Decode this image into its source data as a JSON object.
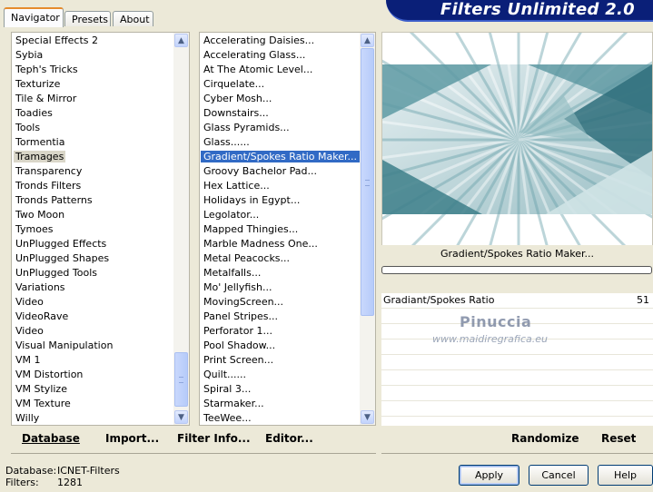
{
  "tabs": [
    {
      "label": "Navigator",
      "active": true
    },
    {
      "label": "Presets",
      "active": false
    },
    {
      "label": "About",
      "active": false
    }
  ],
  "banner": {
    "title": "Filters Unlimited 2.0"
  },
  "categories": {
    "items": [
      "Special Effects 2",
      "Sybia",
      "Teph's Tricks",
      "Texturize",
      "Tile & Mirror",
      "Toadies",
      "Tools",
      "Tormentia",
      "Tramages",
      "Transparency",
      "Tronds Filters",
      "Tronds Patterns",
      "Two Moon",
      "Tymoes",
      "UnPlugged Effects",
      "UnPlugged Shapes",
      "UnPlugged Tools",
      "Variations",
      "Video",
      "VideoRave",
      "Video",
      "Visual Manipulation",
      "VM 1",
      "VM Distortion",
      "VM Stylize",
      "VM Texture",
      "Willy"
    ],
    "selected": "Tramages"
  },
  "filters": {
    "items": [
      "Accelerating Daisies...",
      "Accelerating Glass...",
      "At The Atomic Level...",
      "Cirquelate...",
      "Cyber Mosh...",
      "Downstairs...",
      "Glass Pyramids...",
      "Glass......",
      "Gradient/Spokes Ratio Maker...",
      "Groovy Bachelor Pad...",
      "Hex Lattice...",
      "Holidays in Egypt...",
      "Legolator...",
      "Mapped Thingies...",
      "Marble Madness One...",
      "Metal Peacocks...",
      "Metalfalls...",
      "Mo' Jellyfish...",
      "MovingScreen...",
      "Panel Stripes...",
      "Perforator 1...",
      "Pool Shadow...",
      "Print Screen...",
      "Quilt......",
      "Spiral 3...",
      "Starmaker...",
      "TeeWee..."
    ],
    "selected": "Gradient/Spokes Ratio Maker..."
  },
  "preview": {
    "filter_name": "Gradient/Spokes Ratio Maker...",
    "progress": 0
  },
  "params": [
    {
      "name": "Gradiant/Spokes Ratio",
      "value": "51"
    }
  ],
  "watermark": {
    "line1": "Pinuccia",
    "line2": "www.maidiregrafica.eu"
  },
  "bottom_links": {
    "database": "Database",
    "import": "Import...",
    "filter_info": "Filter Info...",
    "editor": "Editor...",
    "randomize": "Randomize",
    "reset": "Reset"
  },
  "status": {
    "database_label": "Database:",
    "database_value": "ICNET-Filters",
    "filters_label": "Filters:",
    "filters_value": "1281"
  },
  "buttons": {
    "apply": "Apply",
    "cancel": "Cancel",
    "help": "Help"
  },
  "icons": {
    "scroll_up": "chevron-up-icon",
    "scroll_down": "chevron-down-icon"
  }
}
